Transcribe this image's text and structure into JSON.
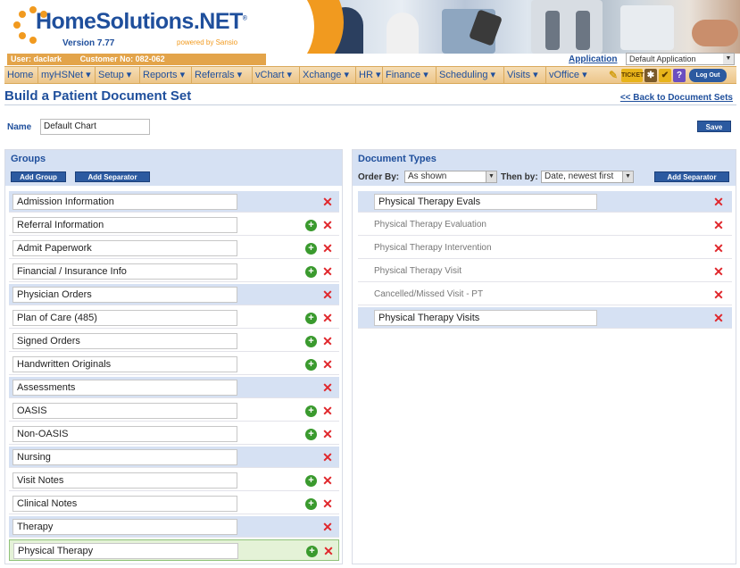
{
  "brand": {
    "title": "HomeSolutions.NET",
    "trademark": "®",
    "version": "Version 7.77",
    "powered_by": "powered by Sansio",
    "colors": {
      "blue": "#1f4f9c",
      "orange": "#f19a1f"
    }
  },
  "user_bar": {
    "user": "User: daclark",
    "customer": "Customer No: 082-062",
    "application_label": "Application",
    "application_value": "Default Application"
  },
  "nav": {
    "items": [
      {
        "label": "Home"
      },
      {
        "label": "myHSNet ▾"
      },
      {
        "label": "Setup ▾"
      },
      {
        "label": "Reports ▾"
      },
      {
        "label": "Referrals ▾"
      },
      {
        "label": "vChart ▾"
      },
      {
        "label": "Xchange ▾"
      },
      {
        "label": "HR ▾"
      },
      {
        "label": "Finance ▾"
      },
      {
        "label": "Scheduling ▾"
      },
      {
        "label": "Visits ▾"
      },
      {
        "label": "vOffice ▾"
      }
    ],
    "ticket_label": "TICKET",
    "logout_label": "Log Out",
    "help_label": "?"
  },
  "page": {
    "title": "Build a Patient Document Set",
    "back_link": "<< Back to Document Sets",
    "name_label": "Name",
    "name_value": "Default Chart",
    "save_label": "Save"
  },
  "groups": {
    "title": "Groups",
    "add_group_label": "Add Group",
    "add_separator_label": "Add Separator",
    "rows": [
      {
        "label": "Admission Information",
        "type": "separator"
      },
      {
        "label": "Referral Information",
        "type": "group"
      },
      {
        "label": "Admit Paperwork",
        "type": "group"
      },
      {
        "label": "Financial / Insurance Info",
        "type": "group"
      },
      {
        "label": "Physician Orders",
        "type": "separator"
      },
      {
        "label": "Plan of Care (485)",
        "type": "group"
      },
      {
        "label": "Signed Orders",
        "type": "group"
      },
      {
        "label": "Handwritten Originals",
        "type": "group"
      },
      {
        "label": "Assessments",
        "type": "separator"
      },
      {
        "label": "OASIS",
        "type": "group"
      },
      {
        "label": "Non-OASIS",
        "type": "group"
      },
      {
        "label": "Nursing",
        "type": "separator"
      },
      {
        "label": "Visit Notes",
        "type": "group"
      },
      {
        "label": "Clinical Notes",
        "type": "group"
      },
      {
        "label": "Therapy",
        "type": "separator"
      },
      {
        "label": "Physical Therapy",
        "type": "selected"
      }
    ]
  },
  "document_types": {
    "title": "Document Types",
    "order_by_label": "Order By:",
    "order_by_value": "As shown",
    "then_by_label": "Then by:",
    "then_by_value": "Date, newest first",
    "add_separator_label": "Add Separator",
    "rows": [
      {
        "label": "Physical Therapy Evals",
        "type": "separator"
      },
      {
        "label": "Physical Therapy Evaluation",
        "type": "doc"
      },
      {
        "label": "Physical Therapy Intervention",
        "type": "doc"
      },
      {
        "label": "Physical Therapy Visit",
        "type": "doc"
      },
      {
        "label": "Cancelled/Missed Visit - PT",
        "type": "doc"
      },
      {
        "label": "Physical Therapy Visits",
        "type": "separator"
      }
    ]
  },
  "icons": {
    "add": "plus-circle-icon",
    "delete": "red-x-icon",
    "dropdown": "chevron-down-icon"
  }
}
